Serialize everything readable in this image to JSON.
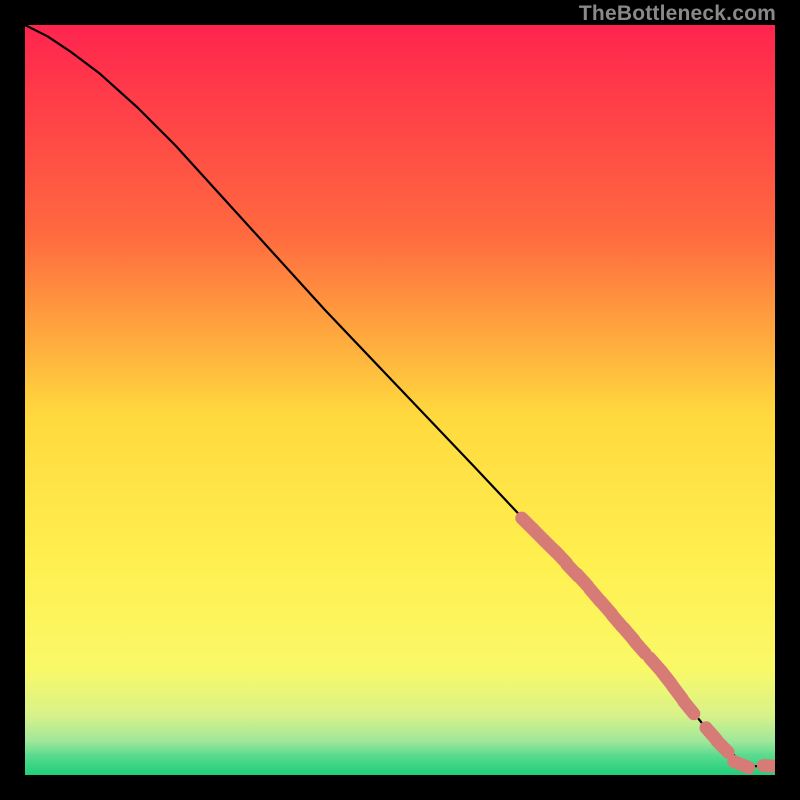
{
  "watermark": "TheBottleneck.com",
  "colors": {
    "background_black": "#000000",
    "curve": "#000000",
    "dot_fill": "#d77b76",
    "gradient_top": "#ff244e",
    "gradient_mid_upper": "#ff8a3a",
    "gradient_mid": "#ffd93e",
    "gradient_mid_lower": "#fbf85a",
    "gradient_band1": "#e6f58a",
    "gradient_band2": "#aee8a0",
    "gradient_band3": "#55d98e",
    "gradient_bottom": "#1fcf7a"
  },
  "chart_data": {
    "type": "line",
    "title": "",
    "xlabel": "",
    "ylabel": "",
    "xlim": [
      0,
      100
    ],
    "ylim": [
      0,
      100
    ],
    "curve": {
      "x": [
        0,
        3,
        6,
        10,
        15,
        20,
        30,
        40,
        50,
        60,
        68,
        72,
        76,
        80,
        84,
        87,
        89,
        91,
        93,
        95,
        97,
        99,
        100
      ],
      "y": [
        100,
        98.5,
        96.5,
        93.5,
        89,
        84,
        73,
        62,
        51.5,
        41,
        32.5,
        28,
        23.5,
        19,
        14.5,
        11,
        8.5,
        6,
        4,
        2.2,
        1.2,
        1.1,
        1.1
      ]
    },
    "series": [
      {
        "name": "highlight-points",
        "type": "scatter",
        "x": [
          67,
          68.5,
          70,
          71.5,
          73,
          74.3,
          76,
          77.5,
          79,
          80.5,
          82,
          84,
          85.5,
          87,
          88.5,
          91.5,
          93,
          95.5,
          99.5
        ],
        "y": [
          33.5,
          32,
          30.5,
          29,
          27.3,
          26,
          24,
          22.3,
          20.5,
          18.8,
          17,
          14.8,
          13,
          11,
          9,
          5.5,
          3.8,
          1.4,
          1.2
        ]
      }
    ]
  }
}
